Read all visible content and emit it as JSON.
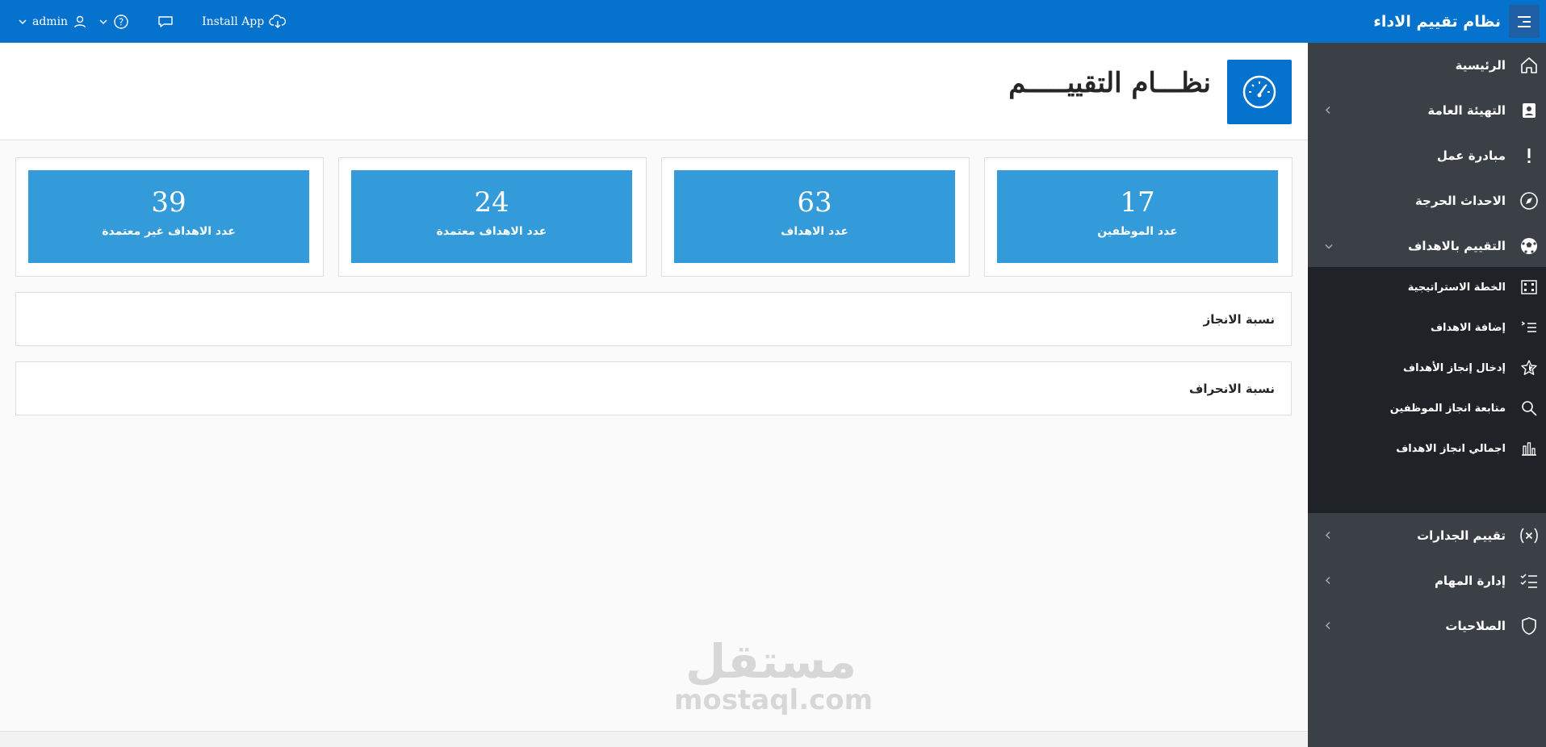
{
  "header": {
    "app_title": "نظام تقييم الاداء",
    "install_app": "Install App",
    "user": "admin",
    "menu_icon": "hamburger-menu-icon",
    "cloud_icon": "cloud-download-icon",
    "chat_icon": "chat-bubble-icon",
    "help_icon": "help-circle-icon",
    "user_icon": "user-icon"
  },
  "sidebar": {
    "items": [
      {
        "label": "الرئيسية",
        "icon": "home-icon"
      },
      {
        "label": "التهيئة العامة",
        "icon": "contact-card-icon"
      },
      {
        "label": "مبادرة عمل",
        "icon": "exclamation-icon"
      },
      {
        "label": "الاحداث الحرجة",
        "icon": "compass-icon"
      },
      {
        "label": "التقييم بالاهداف",
        "icon": "soccer-ball-icon"
      },
      {
        "label": "تقييم الجدارات",
        "icon": "variable-x-icon"
      },
      {
        "label": "إدارة المهام",
        "icon": "checklist-icon"
      },
      {
        "label": "الصلاحيات",
        "icon": "shield-icon"
      }
    ],
    "sub_items": [
      {
        "label": "الخطة الاستراتيجية",
        "icon": "building-grid-icon"
      },
      {
        "label": "إضافة الاهداف",
        "icon": "list-add-icon"
      },
      {
        "label": "إدخال إنجاز الأهداف",
        "icon": "star-icon"
      },
      {
        "label": "متابعة انجاز الموظفين",
        "icon": "search-icon"
      },
      {
        "label": "اجمالي انجاز الاهداف",
        "icon": "bar-chart-icon"
      }
    ]
  },
  "main": {
    "page_title": "نظـــام التقييـــــم",
    "stats": [
      {
        "value": "17",
        "label": "عدد الموظفين"
      },
      {
        "value": "63",
        "label": "عدد الاهداف"
      },
      {
        "value": "24",
        "label": "عدد الاهداف معتمدة"
      },
      {
        "value": "39",
        "label": "عدد الاهداف غير معتمدة"
      }
    ],
    "panels": [
      {
        "title": "نسبة الانجاز"
      },
      {
        "title": "نسبة الانحراف"
      }
    ]
  },
  "watermark": {
    "ar": "مستقل",
    "en": "mostaql.com"
  },
  "colors": {
    "brand": "#0572ce",
    "stat_tile": "#339bd9",
    "sidebar": "#3a4046",
    "sidebar_sub": "#1f2327"
  }
}
